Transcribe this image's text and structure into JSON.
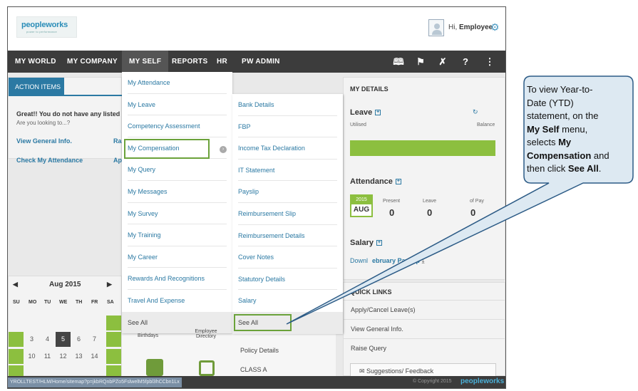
{
  "header": {
    "logo_text": "peopleworks",
    "logo_tagline": "power to performance",
    "greeting_prefix": "Hi, ",
    "greeting_name": "Employee"
  },
  "nav": {
    "items": [
      "MY WORLD",
      "MY COMPANY",
      "MY SELF",
      "REPORTS",
      "HR",
      "PW ADMIN"
    ],
    "active": "MY SELF",
    "tools": [
      "book-icon",
      "flag-icon",
      "tools-icon",
      "help-icon",
      "sitemap-icon"
    ]
  },
  "action_items": {
    "tab": "ACTION ITEMS",
    "message": "Great!! You do not have any listed it",
    "sub": "Are you looking to...?",
    "links": [
      "View General Info.",
      "Check My Attendance",
      "Ra",
      "Ap"
    ]
  },
  "calendar": {
    "title": "Aug 2015",
    "days_of_week": [
      "SU",
      "MO",
      "TU",
      "WE",
      "TH",
      "FR",
      "SA"
    ],
    "row1": [
      "3",
      "4",
      "5",
      "6",
      "7"
    ],
    "row2": [
      "10",
      "11",
      "12",
      "13",
      "14"
    ],
    "today": "5"
  },
  "my_self_menu": {
    "col1": [
      "My Attendance",
      "My Leave",
      "Competency Assessment",
      "My Compensation",
      "My Query",
      "My Messages",
      "My Survey",
      "My Training",
      "My Career",
      "Rewards And Recognitions",
      "Travel And Expense",
      "See All"
    ],
    "col2": [
      "Bank Details",
      "FBP",
      "Income Tax Declaration",
      "IT Statement",
      "Payslip",
      "Reimbursement Slip",
      "Reimbursement Details",
      "Cover Notes",
      "Statutory Details",
      "Salary",
      "See All"
    ],
    "selected": "My Compensation"
  },
  "mid_extra": {
    "birthdays": "Birthdays",
    "directory": "Employee Directory",
    "policy": "Policy Details",
    "class": "CLASS A"
  },
  "my_details": {
    "title": "MY DETAILS",
    "leave": {
      "title": "Leave",
      "utilised": "Utilised",
      "balance": "Balance"
    },
    "attendance": {
      "title": "Attendance",
      "year": "2015",
      "month": "AUG",
      "present_label": "Present",
      "present": "0",
      "leave_label": "Leave",
      "leave": "0",
      "lop_label": "of Pay",
      "lop": "0"
    },
    "salary": {
      "title": "Salary",
      "download": "Downl",
      "payslip": "ebruary Payslip"
    }
  },
  "quick_links": {
    "title": "QUICK LINKS",
    "items": [
      "Apply/Cancel Leave(s)",
      "View General Info.",
      "Raise Query"
    ],
    "feedback": "Suggestions/ Feedback"
  },
  "status_bar": {
    "url": "YROLLTEST/HLM/Home/sitemap?p=jkbRQnbPZo5FslwelM5fpbl3hCCbn1Lx",
    "copyright": "© Copyright 2015",
    "logo": "peopleworks"
  },
  "callout": {
    "line1": "To view Year-to-",
    "line2": "Date (YTD)",
    "line3": "statement, on the",
    "line4_bold": "My Self",
    "line4_rest": " menu,",
    "line5": "selects ",
    "line5_bold": "My",
    "line6_bold": "Compensation",
    "line6_rest": " and",
    "line7": "then click ",
    "line7_bold": "See All",
    "line7_end": "."
  }
}
